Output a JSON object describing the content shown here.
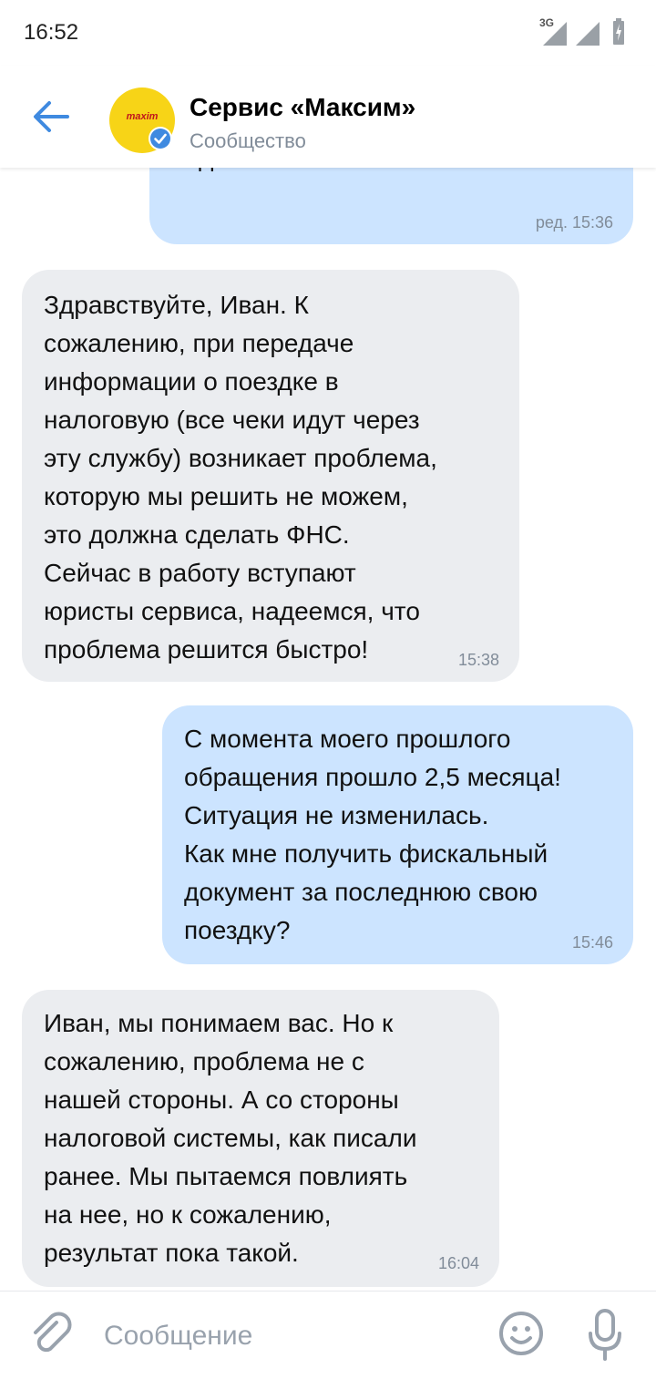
{
  "status_bar": {
    "time": "16:52",
    "network": "3G"
  },
  "header": {
    "title": "Сервис «Максим»",
    "subtitle": "Сообщество",
    "avatar_text": "maxim"
  },
  "messages": [
    {
      "direction": "out",
      "text": "чек? В  отчете о поездке  ничего\nподобного нет.",
      "time": "ред. 15:36"
    },
    {
      "direction": "in",
      "text": "Здравствуйте, Иван. К\nсожалению, при передаче\nинформации о поездке в\nналоговую (все чеки идут через\nэту службу) возникает проблема,\nкоторую мы решить не можем,\nэто должна сделать ФНС.\nСейчас в работу вступают\nюристы сервиса, надеемся, что\nпроблема решится быстро!",
      "time": "15:38"
    },
    {
      "direction": "out",
      "text": "С момента моего прошлого\nобращения прошло 2,5 месяца!\nСитуация не изменилась.\nКак мне получить фискальный\nдокумент за последнюю свою\nпоездку?",
      "time": "15:46"
    },
    {
      "direction": "in",
      "text": "Иван, мы понимаем вас. Но к\nсожалению, проблема не с\nнашей стороны. А со стороны\nналоговой системы, как писали\nранее. Мы пытаемся повлиять\nна нее, но к сожалению,\nрезультат пока такой.",
      "time": "16:04"
    }
  ],
  "composer": {
    "placeholder": "Сообщение",
    "value": ""
  },
  "colors": {
    "accent": "#3f8ae0",
    "incoming_bubble": "#ebedf0",
    "outgoing_bubble": "#cce4ff",
    "secondary_text": "#818c99",
    "avatar_bg": "#f7d417"
  },
  "icons": [
    "back-arrow-icon",
    "verified-icon",
    "attach-icon",
    "emoji-icon",
    "microphone-icon",
    "signal-icon",
    "battery-icon"
  ]
}
